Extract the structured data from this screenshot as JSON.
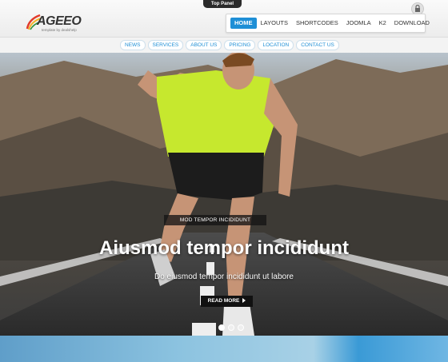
{
  "top_panel": {
    "label": "Top Panel"
  },
  "logo": {
    "word": "AGEEO",
    "tagline": "template by dealshelp"
  },
  "main_nav": [
    {
      "label": "HOME",
      "active": true
    },
    {
      "label": "LAYOUTS"
    },
    {
      "label": "SHORTCODES"
    },
    {
      "label": "JOOMLA"
    },
    {
      "label": "K2"
    },
    {
      "label": "DOWNLOAD"
    }
  ],
  "sub_nav": [
    {
      "label": "NEWS"
    },
    {
      "label": "SERVICES"
    },
    {
      "label": "ABOUT US"
    },
    {
      "label": "PRICING"
    },
    {
      "label": "LOCATION"
    },
    {
      "label": "CONTACT US"
    }
  ],
  "hero": {
    "tag": "MOD TEMPOR INCIDIDUNT",
    "title": "Aiusmod tempor incididunt",
    "subtitle": "Do eiusmod tempor incididunt ut labore",
    "button_label": "READ MORE",
    "slides_total": 3,
    "active_slide": 1
  },
  "colors": {
    "accent": "#1e8fd6",
    "runner_shirt": "#c6e82e"
  }
}
